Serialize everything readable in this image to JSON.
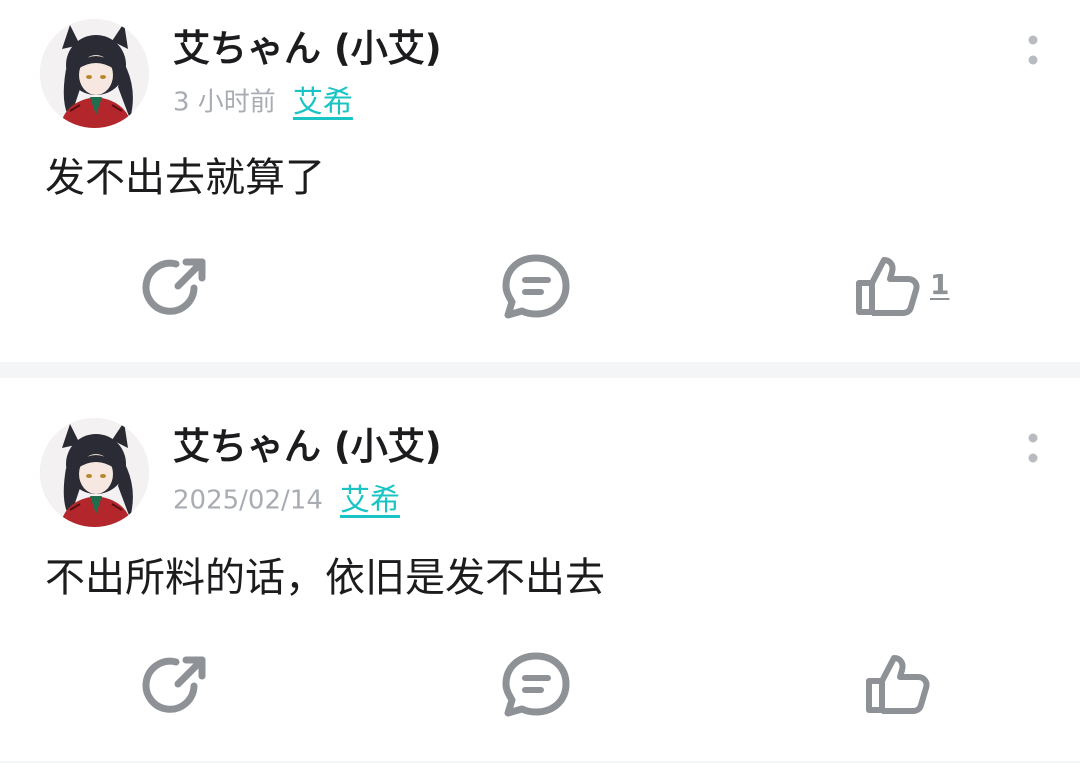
{
  "posts": [
    {
      "username": "艾ちゃん (小艾)",
      "timestamp": "3 小时前",
      "topic": "艾希",
      "text": "发不出去就算了",
      "like_count": "1"
    },
    {
      "username": "艾ちゃん (小艾)",
      "timestamp": "2025/02/14",
      "topic": "艾希",
      "text": "不出所料的话，依旧是发不出去",
      "like_count": ""
    }
  ],
  "colors": {
    "topic_link": "#1bc4c4",
    "icon_gray": "#8e9196",
    "muted_text": "#a9adb3",
    "separator": "#f4f5f7"
  },
  "icons": [
    "more-vertical-icon",
    "share-icon",
    "comment-icon",
    "thumbs-up-icon"
  ]
}
